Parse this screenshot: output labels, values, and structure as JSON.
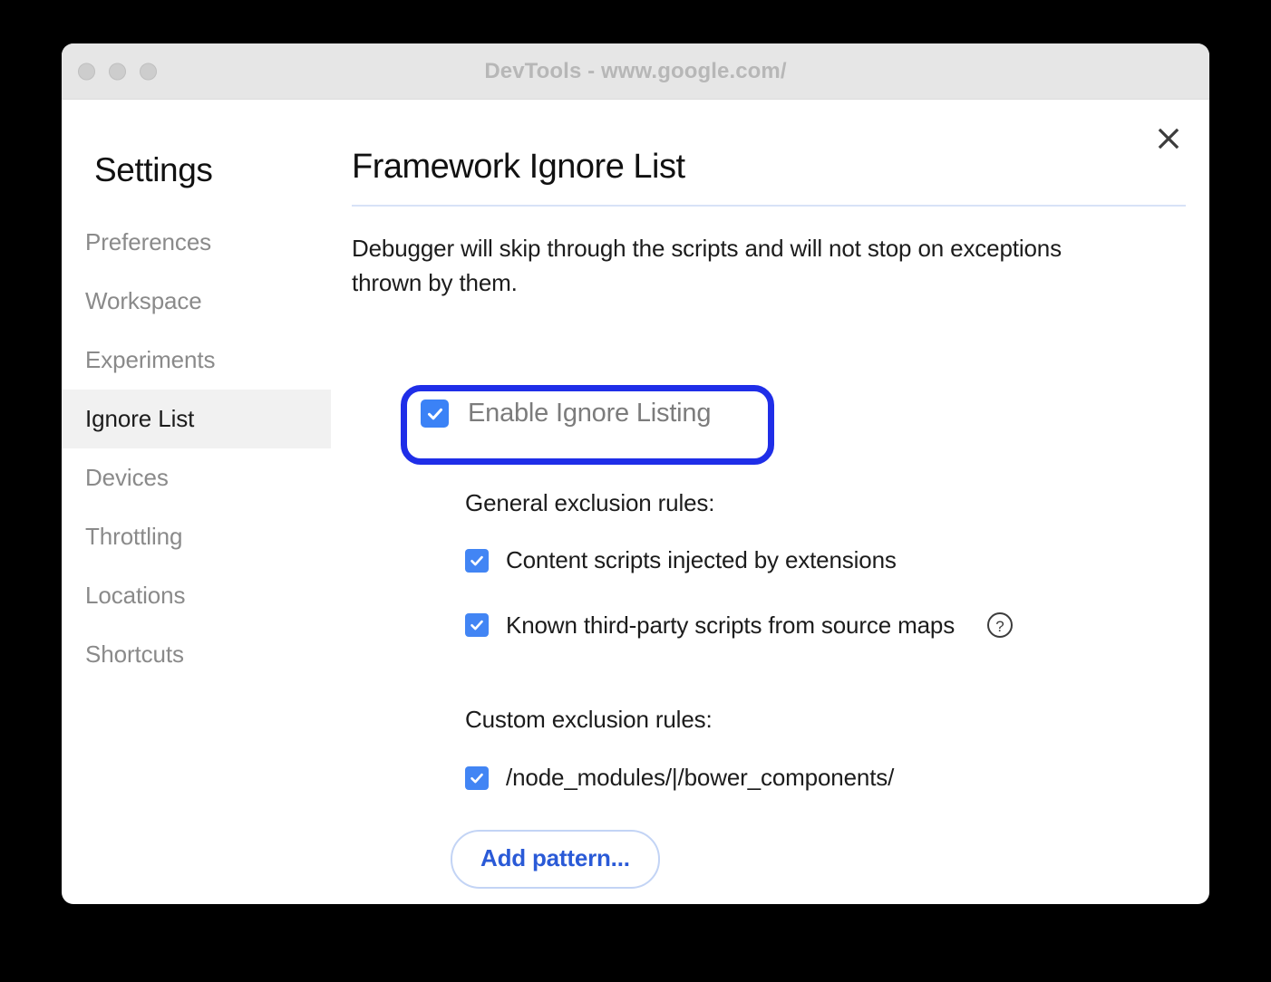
{
  "window": {
    "title": "DevTools - www.google.com/",
    "traffic_lights": [
      "close",
      "minimize",
      "maximize"
    ]
  },
  "sidebar": {
    "title": "Settings",
    "items": [
      {
        "label": "Preferences",
        "active": false
      },
      {
        "label": "Workspace",
        "active": false
      },
      {
        "label": "Experiments",
        "active": false
      },
      {
        "label": "Ignore List",
        "active": true
      },
      {
        "label": "Devices",
        "active": false
      },
      {
        "label": "Throttling",
        "active": false
      },
      {
        "label": "Locations",
        "active": false
      },
      {
        "label": "Shortcuts",
        "active": false
      }
    ]
  },
  "main": {
    "title": "Framework Ignore List",
    "description": "Debugger will skip through the scripts and will not stop on exceptions thrown by them.",
    "close_label": "Close",
    "enable": {
      "label": "Enable Ignore Listing",
      "checked": true,
      "highlighted": true
    },
    "general_rules": {
      "heading": "General exclusion rules:",
      "items": [
        {
          "label": "Content scripts injected by extensions",
          "checked": true,
          "help": false
        },
        {
          "label": "Known third-party scripts from source maps",
          "checked": true,
          "help": true
        }
      ]
    },
    "custom_rules": {
      "heading": "Custom exclusion rules:",
      "items": [
        {
          "label": "/node_modules/|/bower_components/",
          "checked": true
        }
      ]
    },
    "add_pattern_label": "Add pattern..."
  },
  "colors": {
    "accent_blue": "#4285f4",
    "highlight_blue": "#1f2ee8",
    "button_text_blue": "#2a5ad7",
    "divider_blue": "#d8e2f7",
    "titlebar_gray": "#e6e6e6",
    "active_item_gray": "#f1f1f1"
  }
}
